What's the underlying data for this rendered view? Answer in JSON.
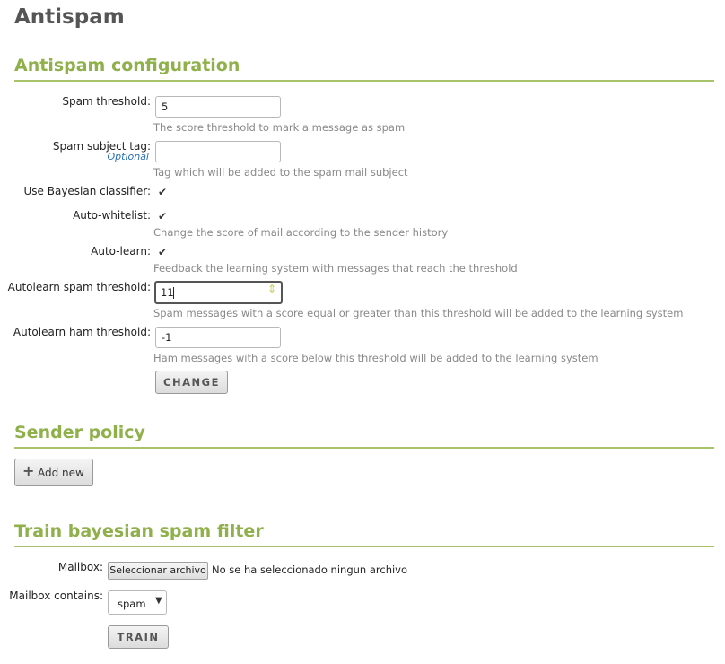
{
  "page_title": "Antispam",
  "config": {
    "title": "Antispam configuration",
    "spam_threshold": {
      "label": "Spam threshold:",
      "value": "5",
      "help": "The score threshold to mark a message as spam"
    },
    "subject_tag": {
      "label": "Spam subject tag:",
      "optional": "Optional",
      "value": "",
      "help": "Tag which will be added to the spam mail subject"
    },
    "bayesian": {
      "label": "Use Bayesian classifier:",
      "checked": true
    },
    "auto_whitelist": {
      "label": "Auto-whitelist:",
      "checked": true,
      "help": "Change the score of mail according to the sender history"
    },
    "auto_learn": {
      "label": "Auto-learn:",
      "checked": true,
      "help": "Feedback the learning system with messages that reach the threshold"
    },
    "autolearn_spam": {
      "label": "Autolearn spam threshold:",
      "value": "11",
      "help": "Spam messages with a score equal or greater than this threshold will be added to the learning system"
    },
    "autolearn_ham": {
      "label": "Autolearn ham threshold:",
      "value": "-1",
      "help": "Ham messages with a score below this threshold will be added to the learning system"
    },
    "change_label": "CHANGE"
  },
  "sender_policy": {
    "title": "Sender policy",
    "add_new_label": "Add new"
  },
  "train": {
    "title": "Train bayesian spam filter",
    "mailbox_label": "Mailbox:",
    "file_button_label": "Seleccionar archivo",
    "file_status": "No se ha seleccionado ningun archivo",
    "contains_label": "Mailbox contains:",
    "contains_value": "spam",
    "train_label": "TRAIN"
  },
  "icons": {
    "checkbox": "checkmark-icon",
    "add": "plus-icon",
    "dropdown": "triangle-down-icon",
    "spin": "spinner-icon"
  }
}
